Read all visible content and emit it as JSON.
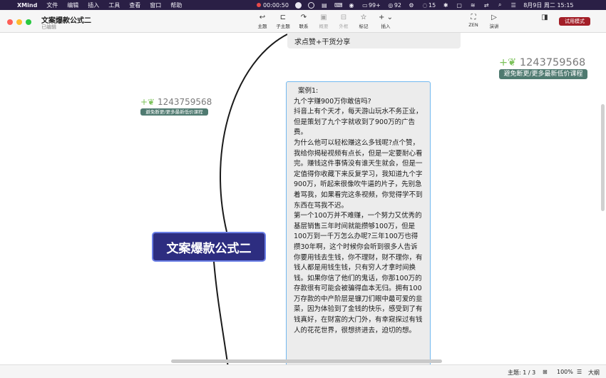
{
  "menubar": {
    "app_name": "XMind",
    "menus": [
      "文件",
      "编辑",
      "插入",
      "工具",
      "查看",
      "窗口",
      "帮助"
    ],
    "recording_time": "00:00:50",
    "battery": "99+",
    "wechat_count": "92",
    "messages_count": "15",
    "clock": "8月9日 周二 15:15"
  },
  "window": {
    "title": "文案爆款公式二",
    "subtitle": "已编辑",
    "trial_badge": "试用模式"
  },
  "toolbar": {
    "topic": "主题",
    "subtopic": "子主题",
    "relation": "联系",
    "summary": "概要",
    "boundary": "外框",
    "marker": "标记",
    "insert": "插入",
    "zen": "ZEN",
    "pitch": "演讲"
  },
  "canvas": {
    "top_node": "求点赞+干货分享",
    "main_topic": "文案爆款公式二",
    "note": {
      "heading": "案例1:",
      "body": "九个字赚900万你敢信吗?\n抖音上有个天才，每天游山玩水不务正业，但是策划了九个字就收到了900万的广告费。\n为什么他可以轻松赚这么多钱呢?点个赞，我给你揭秘视频有点长，但是一定要耐心看完。赚钱这件事情没有谁天生就会，但是一定值得你收藏下来反复学习，我知道九个字900万，听起来很像吹牛逼的片子，先别急着骂我，如果看完这条视频，你觉得学不到东西在骂我不迟。\n第一个100万并不难赚，一个努力又优秀的基层销售三年时间就能攒够100万，但是100万到一千万怎么办呢?三年100万也得攒30年啊，这个时候你会听到很多人告诉你要用钱去生钱，你不理财，财不理你，有钱人都是用钱生钱，只有穷人才拿时间换钱。如果你信了他们的鬼话，你那100万的存款很有可能会被骗得血本无归。拥有100万存款的中产阶层是镰刀们眼中最可爱的韭菜，因为体验到了金钱的快乐，感受到了有钱真好，在财富的大门外，有幸窥探过有钱人的花花世界，很想挤进去，迫切的想。"
    },
    "watermark_small": {
      "number": "1243759568",
      "caption": "避免断更/更多最新低价课程"
    },
    "watermark_large": {
      "number": "1243759568",
      "caption": "避免断更/更多最新低价课程"
    }
  },
  "statusbar": {
    "topic_count": "主题: 1 / 3",
    "zoom": "100%",
    "outline": "大纲"
  },
  "colors": {
    "main_topic_fill": "#2d2d80",
    "main_topic_border": "#6b7fe6",
    "note_border": "#72b8ef",
    "trial_badge": "#a31f28",
    "menubar": "#2a1f45"
  }
}
